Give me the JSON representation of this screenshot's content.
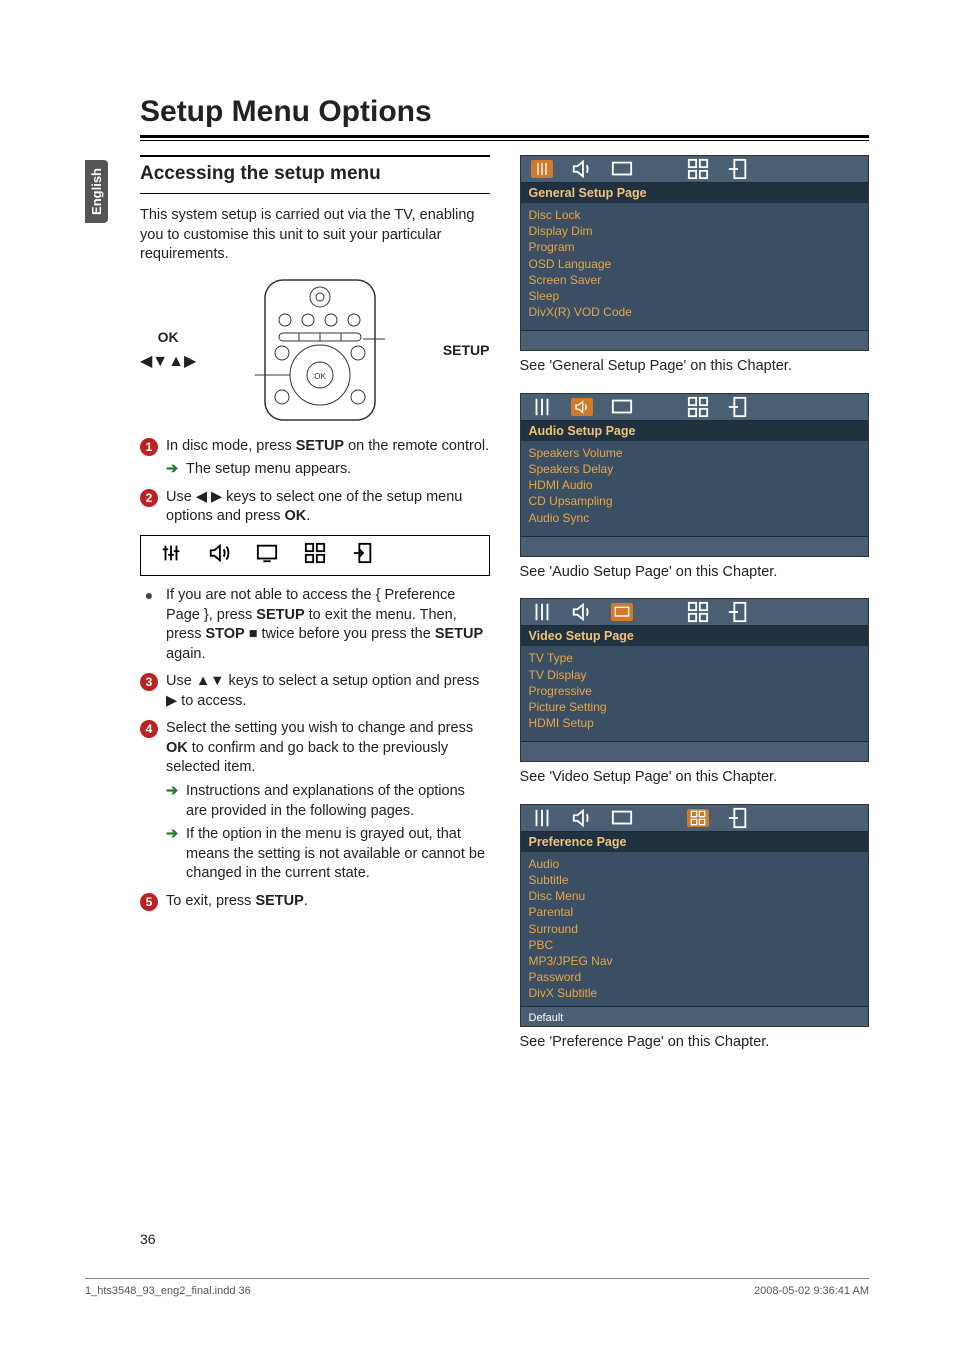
{
  "sideTab": "English",
  "title": "Setup Menu Options",
  "subheading": "Accessing the setup menu",
  "intro": "This system setup is carried out via the TV, enabling you to customise this unit to suit your particular requirements.",
  "remote": {
    "left": "OK",
    "right": "SETUP",
    "arrows": "◀▼▲▶"
  },
  "steps": {
    "s1a": "In disc mode, press ",
    "s1b": "SETUP",
    "s1c": " on the remote control.",
    "s1arrow": "The setup menu appears.",
    "s2a": "Use ◀ ▶ keys to select one of the setup menu options and press ",
    "s2b": "OK",
    "s2c": ".",
    "bulletA": "If you are not able to access the { Preference Page }, press ",
    "bulletB": "SETUP",
    "bulletC": " to exit the menu. Then, press ",
    "bulletD": "STOP",
    "bulletE": " ■ twice before you press the ",
    "bulletF": "SETUP",
    "bulletG": " again.",
    "s3": "Use ▲▼ keys to select a setup option and press ▶ to access.",
    "s4a": "Select the setting you wish to change and press ",
    "s4b": "OK",
    "s4c": " to confirm and go back to the previously selected item.",
    "s4arrow1": "Instructions and explanations of the options are provided in the following pages.",
    "s4arrow2": "If the option in the menu is grayed out, that means the setting is not available or cannot be changed in the current state.",
    "s5a": "To exit, press ",
    "s5b": "SETUP",
    "s5c": "."
  },
  "osd": {
    "general": {
      "title": "General Setup Page",
      "items": [
        "Disc Lock",
        "Display Dim",
        "Program",
        "OSD Language",
        "Screen Saver",
        "Sleep",
        "DivX(R) VOD Code"
      ],
      "caption": "See 'General Setup Page' on this Chapter."
    },
    "audio": {
      "title": "Audio Setup Page",
      "items": [
        "Speakers Volume",
        "Speakers Delay",
        "HDMI Audio",
        "CD Upsampling",
        "Audio Sync"
      ],
      "caption": "See 'Audio Setup Page' on this Chapter."
    },
    "video": {
      "title": "Video Setup Page",
      "items": [
        "TV Type",
        "TV Display",
        "Progressive",
        "Picture Setting",
        "HDMI Setup"
      ],
      "caption": "See 'Video Setup Page' on this Chapter."
    },
    "pref": {
      "title": "Preference Page",
      "items": [
        "Audio",
        "Subtitle",
        "Disc Menu",
        "Parental",
        "Surround",
        "PBC",
        "MP3/JPEG Nav",
        "Password",
        "DivX Subtitle"
      ],
      "footer": "Default",
      "caption": "See 'Preference Page' on this Chapter."
    }
  },
  "pageNum": "36",
  "footer": {
    "left": "1_hts3548_93_eng2_final.indd   36",
    "right": "2008-05-02   9:36:41 AM"
  }
}
